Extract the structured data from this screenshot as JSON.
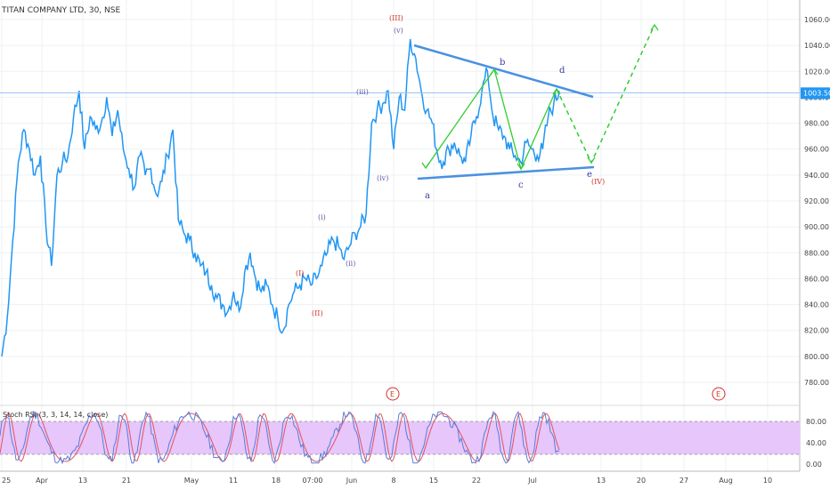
{
  "header": {
    "title": "TITAN COMPANY LTD, 30, NSE"
  },
  "price_axis": {
    "ticks": [
      "1060.00",
      "1040.00",
      "1020.00",
      "1000.00",
      "980.00",
      "960.00",
      "940.00",
      "920.00",
      "900.00",
      "880.00",
      "860.00",
      "840.00",
      "820.00",
      "800.00",
      "780.00"
    ],
    "current_price_label": "1003.50",
    "current_price": 1003.5
  },
  "time_axis": {
    "ticks": [
      "25",
      "Apr",
      "13",
      "21",
      "May",
      "11",
      "18",
      "07:00",
      "Jun",
      "8",
      "15",
      "22",
      "Jul",
      "13",
      "20",
      "27",
      "Aug",
      "10"
    ]
  },
  "indicator": {
    "title": "Stoch RSI (3, 3, 14, 14, close)",
    "ticks": [
      "80.00",
      "40.00",
      "0.00"
    ],
    "upper_band": 80,
    "lower_band": 20
  },
  "annotations": {
    "waves": {
      "III_top": "(III)",
      "v": "(v)",
      "iii": "(iii)",
      "iv": "(iv)",
      "i": "(i)",
      "ii": "(ii)",
      "I": "(I)",
      "II": "(II)",
      "IV": "(IV)"
    },
    "abcde": {
      "a": "a",
      "b": "b",
      "c": "c",
      "d": "d",
      "e": "e"
    },
    "event_badge": "E"
  },
  "colors": {
    "price_line": "#2196f3",
    "trendline": "#4a90e2",
    "projection": "#33cc33",
    "stoch_k": "#5a7dd6",
    "stoch_d": "#e5525b",
    "stoch_band": "#e6c6fb",
    "price_label_bg": "#2196f3"
  },
  "chart_data": {
    "type": "line",
    "title": "TITAN COMPANY LTD, 30, NSE",
    "xlabel": "",
    "ylabel": "",
    "ylim": [
      770,
      1070
    ],
    "x_tick_labels": [
      "25",
      "Apr",
      "13",
      "21",
      "May",
      "11",
      "18",
      "07:00",
      "Jun",
      "8",
      "15",
      "22",
      "Jul",
      "13",
      "20",
      "27",
      "Aug",
      "10"
    ],
    "y_tick_labels": [
      "1060.00",
      "1040.00",
      "1020.00",
      "1000.00",
      "980.00",
      "960.00",
      "940.00",
      "920.00",
      "900.00",
      "880.00",
      "860.00",
      "840.00",
      "820.00",
      "800.00",
      "780.00"
    ],
    "series": [
      {
        "values": [
          800,
          830,
          890,
          950,
          975,
          960,
          940,
          955,
          900,
          870,
          940,
          950,
          955,
          985,
          1005,
          960,
          985,
          975,
          980,
          1000,
          970,
          990,
          960,
          945,
          930,
          955,
          940,
          945,
          925,
          935,
          955,
          975,
          905,
          895,
          890,
          880,
          870,
          865,
          855,
          845,
          840,
          835,
          850,
          835,
          865,
          880,
          860,
          850,
          855,
          840,
          830,
          820,
          840,
          850,
          855,
          860,
          855,
          860,
          870,
          880,
          890,
          885,
          875,
          885,
          895,
          900,
          910,
          980,
          990,
          995,
          1005,
          960,
          1000,
          990,
          1045,
          1030,
          1005,
          990,
          980,
          955,
          950,
          960,
          965,
          955,
          950,
          970,
          985,
          1005,
          1020,
          985,
          975,
          970,
          960,
          955,
          950,
          965,
          960,
          955,
          960,
          985,
          995,
          1005
        ]
      }
    ],
    "annotated_points": [
      {
        "label": "a",
        "value": 945
      },
      {
        "label": "b",
        "value": 1021
      },
      {
        "label": "c",
        "value": 948
      },
      {
        "label": "d",
        "value": 1006
      },
      {
        "label": "e",
        "value": 950
      }
    ],
    "projection_target": 1060
  }
}
